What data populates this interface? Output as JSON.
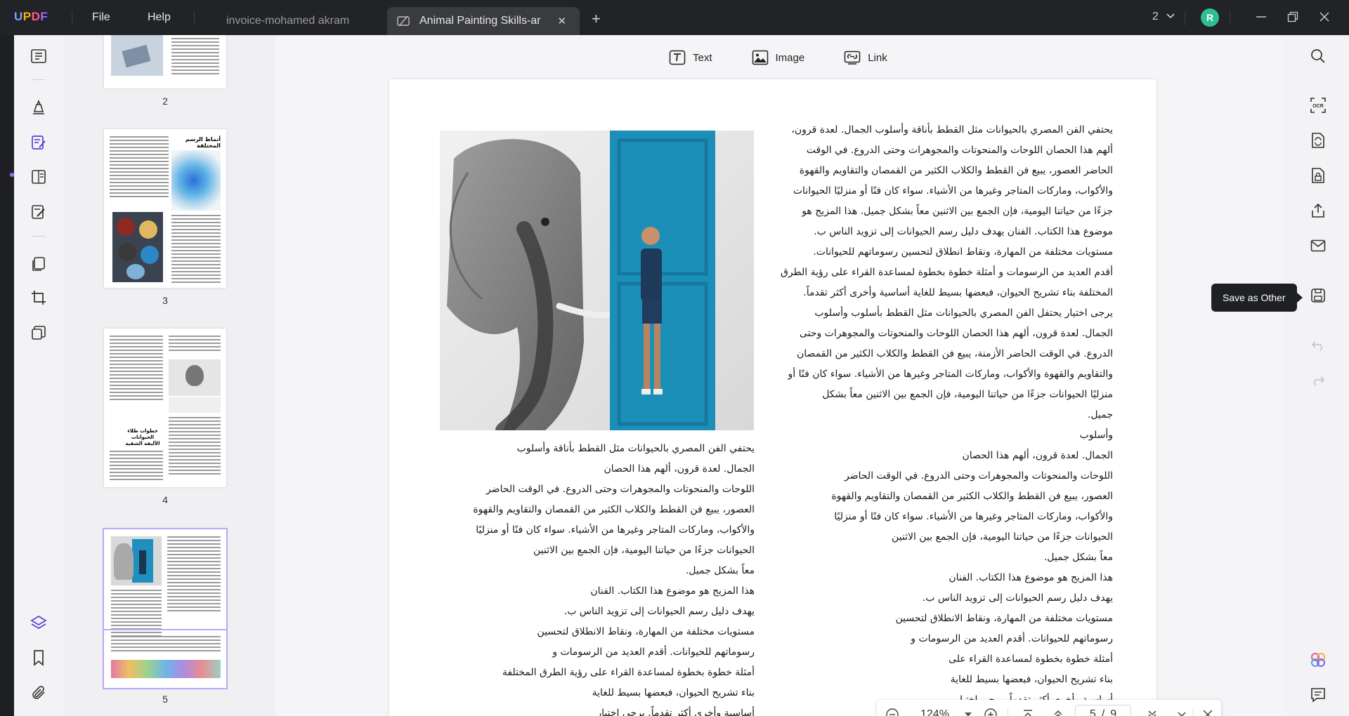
{
  "app": {
    "logo": {
      "u": "U",
      "p": "P",
      "d": "D",
      "f": "F"
    },
    "menu": {
      "file": "File",
      "help": "Help"
    },
    "tabs": [
      {
        "label": "invoice-mohamed akram",
        "active": false
      },
      {
        "label": "Animal Painting Skills-ar",
        "active": true
      }
    ],
    "tab_close": "✕",
    "new_tab": "+",
    "open_docs_count": "2",
    "avatar_initial": "R",
    "accent_color": "#9a6bff"
  },
  "edit_toolbar": {
    "text_label": "Text",
    "image_label": "Image",
    "link_label": "Link"
  },
  "thumbnails": [
    {
      "page": "2"
    },
    {
      "page": "3",
      "heading": "أنماط الرسم المختلفة"
    },
    {
      "page": "4",
      "heading": "خطوات طلاء الحيوانات الأليفة الشقية"
    },
    {
      "page": "5",
      "selected": true
    }
  ],
  "document": {
    "right_column": [
      "يحتفي الفن المصري بالحيوانات مثل القطط بأناقة وأسلوب الجمال. لعدة قرون،",
      "ألهم هذا الحصان اللوحات والمنحوتات والمجوهرات وحتى الدروع. في الوقت",
      "الحاضر العصور، يبيع فن القطط والكلاب الكثير من القمصان والتقاويم والقهوة",
      "والأكواب، وماركات المتاجر وغيرها من الأشياء. سواء كان فنًا أو منزليًا الحيوانات",
      "جزءًا من حياتنا اليومية، فإن الجمع بين الاثنين معاً بشكل جميل. هذا المزيج هو",
      "موضوع هذا الكتاب. الفنان يهدف دليل رسم الحيوانات إلى تزويد الناس ب.",
      "مستويات مختلفة من المهارة، ونقاط انطلاق لتحسين رسوماتهم للحيوانات.",
      "أقدم العديد من الرسومات و أمثلة خطوة بخطوة لمساعدة القراء على رؤية الطرق",
      "المختلفة بناء تشريح الحيوان، فبعضها بسيط للغاية أساسية وأخرى أكثر تقدماً.",
      "يرجى اختيار يحتفل الفن المصري بالحيوانات مثل القطط بأسلوب وأسلوب",
      "الجمال. لعدة قرون، ألهم هذا الحصان اللوحات والمنحوتات والمجوهرات وحتى",
      "الدروع. في الوقت الحاضر الأزمنة، يبيع فن القطط والكلاب الكثير من القمصان",
      "والتقاويم والقهوة والأكواب، وماركات المتاجر وغيرها من الأشياء. سواء كان فنًا أو",
      "منزليًا الحيوانات جزءًا من حياتنا اليومية، فإن الجمع بين الاثنين معاً بشكل",
      "جميل.",
      "وأسلوب",
      "الجمال. لعدة قرون، ألهم هذا الحصان",
      "اللوحات والمنحوتات والمجوهرات وحتى الدروع. في الوقت الحاضر",
      "العصور، يبيع فن القطط والكلاب الكثير من القمصان والتقاويم والقهوة",
      "والأكواب، وماركات المتاجر وغيرها من الأشياء. سواء كان فنًا أو منزليًا",
      "الحيوانات جزءًا من حياتنا اليومية، فإن الجمع بين الاثنين",
      "معاً بشكل جميل.",
      "هذا المزيج هو موضوع هذا الكتاب. الفنان",
      "يهدف دليل رسم الحيوانات إلى تزويد الناس ب.",
      "مستويات مختلفة من المهارة، ونقاط الانطلاق لتحسين",
      "رسوماتهم للحيوانات. أقدم العديد من الرسومات و",
      "أمثلة خطوة بخطوة لمساعدة القراء على",
      "بناء تشريح الحيوان، فبعضها بسيط للغاية",
      "أساسية وأخرى أكثر تقدماً. يرجى اختيار"
    ],
    "left_column": [
      "يحتفي الفن المصري بالحيوانات مثل القطط بأناقة وأسلوب",
      "الجمال. لعدة قرون، ألهم هذا الحصان",
      "اللوحات والمنحوتات والمجوهرات وحتى الدروع. في الوقت الحاضر",
      "العصور، يبيع فن القطط والكلاب الكثير من القمصان والتقاويم والقهوة",
      "والأكواب، وماركات المتاجر وغيرها من الأشياء. سواء كان فنًا أو منزليًا",
      "الحيوانات جزءًا من حياتنا اليومية، فإن الجمع بين الاثنين",
      "معاً بشكل جميل.",
      "هذا المزيج هو موضوع هذا الكتاب. الفنان",
      "يهدف دليل رسم الحيوانات إلى تزويد الناس ب.",
      "مستويات مختلفة من المهارة، ونقاط الانطلاق لتحسين",
      "رسوماتهم للحيوانات. أقدم العديد من الرسومات و",
      "أمثلة خطوة بخطوة لمساعدة القراء على رؤية الطرق المختلفة",
      "بناء تشريح الحيوان، فبعضها بسيط للغاية",
      "أساسية وأخرى أكثر تقدماً. يرجى اختيار"
    ]
  },
  "navigation": {
    "zoom": "124%",
    "current_page": "5",
    "separator": "/",
    "total_pages": "9"
  },
  "right_rail": {
    "tooltip": "Save as Other",
    "ocr_label": "OCR"
  }
}
